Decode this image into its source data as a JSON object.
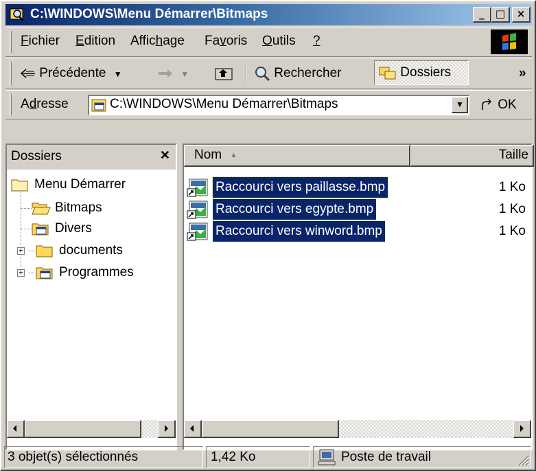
{
  "window": {
    "title": "C:\\WINDOWS\\Menu Démarrer\\Bitmaps",
    "minimize_glyph": "_",
    "maximize_glyph": "□",
    "close_glyph": "×"
  },
  "menu": {
    "items": [
      {
        "pre": "",
        "key": "F",
        "post": "ichier"
      },
      {
        "pre": "",
        "key": "E",
        "post": "dition"
      },
      {
        "pre": "Affic",
        "key": "h",
        "post": "age"
      },
      {
        "pre": "Fa",
        "key": "v",
        "post": "oris"
      },
      {
        "pre": "",
        "key": "O",
        "post": "utils"
      },
      {
        "pre": "",
        "key": "?",
        "post": ""
      }
    ]
  },
  "toolbar": {
    "back_label": "Précédente",
    "back_icon": "arrow-left-icon",
    "forward_icon": "arrow-right-icon",
    "up_icon": "folder-up-icon",
    "search_label": "Rechercher",
    "folders_label": "Dossiers",
    "more_glyph": "»"
  },
  "address": {
    "label_pre": "A",
    "label_key": "d",
    "label_post": "resse",
    "value": "C:\\WINDOWS\\Menu Démarrer\\Bitmaps",
    "go_label": "OK"
  },
  "folders_pane": {
    "title": "Dossiers",
    "close_glyph": "✕",
    "tree": [
      {
        "label": "Menu Démarrer",
        "icon": "folder-icon"
      },
      {
        "label": "Bitmaps",
        "icon": "open-folder-icon"
      },
      {
        "label": "Divers",
        "icon": "program-folder-icon"
      },
      {
        "label": "documents",
        "icon": "folder-icon"
      },
      {
        "label": "Programmes",
        "icon": "program-folder-icon"
      }
    ],
    "expander_glyph": "+"
  },
  "file_list": {
    "columns": {
      "name": "Nom",
      "size": "Taille",
      "sort_glyph": "▲"
    },
    "files": [
      {
        "name": "Raccourci vers paillasse.bmp",
        "size": "1 Ko"
      },
      {
        "name": "Raccourci vers egypte.bmp",
        "size": "1 Ko"
      },
      {
        "name": "Raccourci vers winword.bmp",
        "size": "1 Ko"
      }
    ]
  },
  "statusbar": {
    "selection": "3 objet(s) sélectionnés",
    "size": "1,42 Ko",
    "zone": "Poste de travail"
  },
  "colors": {
    "title_start": "#0a246a",
    "title_end": "#a6caf0",
    "face": "#d4d0c8",
    "selection": "#0a246a"
  }
}
